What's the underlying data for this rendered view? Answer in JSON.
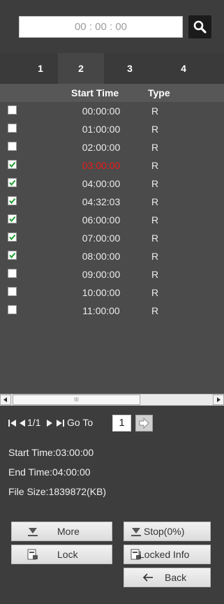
{
  "search": {
    "time_value": "00 : 00 : 00",
    "icon": "search-icon"
  },
  "tabs": [
    {
      "label": "1",
      "active": false
    },
    {
      "label": "2",
      "active": true
    },
    {
      "label": "3",
      "active": false
    },
    {
      "label": "4",
      "active": false
    }
  ],
  "table": {
    "headers": {
      "start_time": "Start Time",
      "type": "Type"
    },
    "rows": [
      {
        "time": "00:00:00",
        "type": "R",
        "checked": false,
        "highlight": false
      },
      {
        "time": "01:00:00",
        "type": "R",
        "checked": false,
        "highlight": false
      },
      {
        "time": "02:00:00",
        "type": "R",
        "checked": false,
        "highlight": false
      },
      {
        "time": "03:00:00",
        "type": "R",
        "checked": true,
        "highlight": true
      },
      {
        "time": "04:00:00",
        "type": "R",
        "checked": true,
        "highlight": false
      },
      {
        "time": "04:32:03",
        "type": "R",
        "checked": true,
        "highlight": false
      },
      {
        "time": "06:00:00",
        "type": "R",
        "checked": true,
        "highlight": false
      },
      {
        "time": "07:00:00",
        "type": "R",
        "checked": true,
        "highlight": false
      },
      {
        "time": "08:00:00",
        "type": "R",
        "checked": true,
        "highlight": false
      },
      {
        "time": "09:00:00",
        "type": "R",
        "checked": false,
        "highlight": false
      },
      {
        "time": "10:00:00",
        "type": "R",
        "checked": false,
        "highlight": false
      },
      {
        "time": "11:00:00",
        "type": "R",
        "checked": false,
        "highlight": false
      }
    ]
  },
  "pager": {
    "page": "1/1",
    "goto_label": "Go To",
    "goto_value": "1"
  },
  "info": {
    "start_time": "Start Time:03:00:00",
    "end_time": "End Time:04:00:00",
    "file_size": "File Size:1839872(KB)"
  },
  "buttons": {
    "more": "More",
    "stop": "Stop(0%)",
    "lock": "Lock",
    "locked_info": "Locked Info",
    "back": "Back"
  },
  "colors": {
    "highlight_time": "#ee1a1a",
    "check_green": "#1e9b2e",
    "panel_bg": "#3d3d3d"
  }
}
